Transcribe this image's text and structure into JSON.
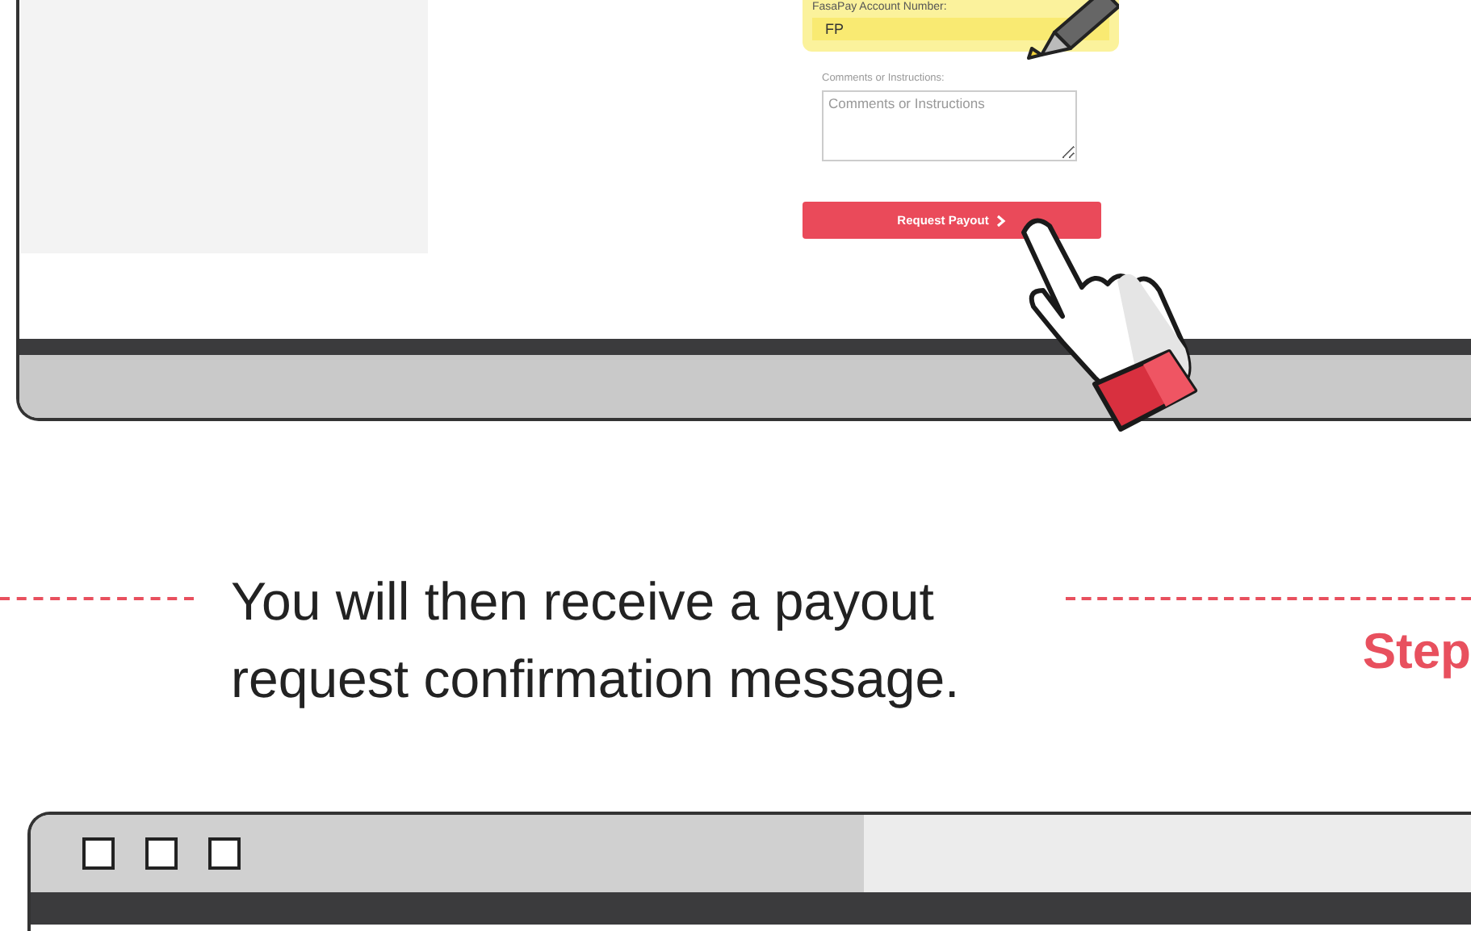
{
  "upper_window": {
    "account_label": "FasaPay Account Number:",
    "account_value": "FP",
    "comments_label": "Comments or Instructions:",
    "comments_placeholder": "Comments or Instructions",
    "button": "Request Payout"
  },
  "caption": "You will then receive a payout request confirmation message.",
  "step_label": "Step"
}
